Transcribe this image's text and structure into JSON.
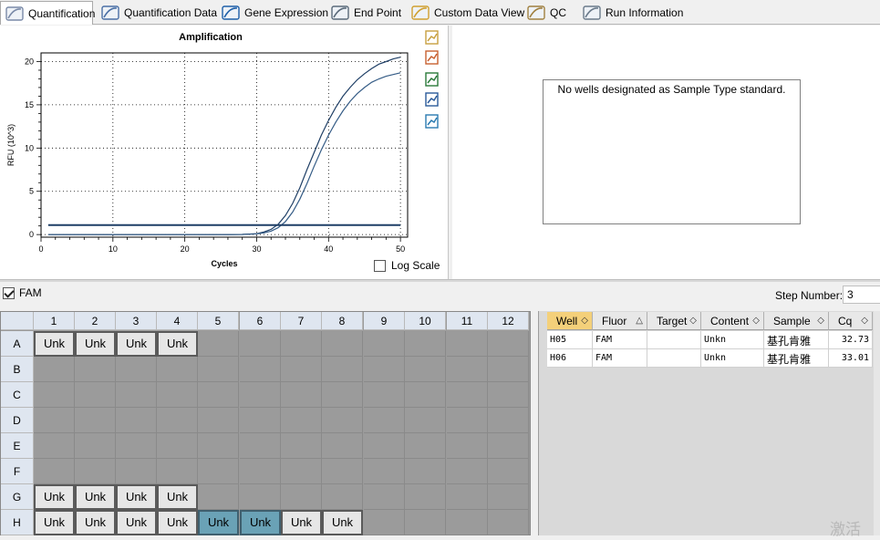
{
  "tabs": [
    {
      "label": "Quantification",
      "icon": "quantification-icon",
      "active": true
    },
    {
      "label": "Quantification Data",
      "icon": "quantification-data-icon"
    },
    {
      "label": "Gene Expression",
      "icon": "gene-expression-icon"
    },
    {
      "label": "End Point",
      "icon": "end-point-icon"
    },
    {
      "label": "Custom Data View",
      "icon": "custom-data-view-icon"
    },
    {
      "label": "QC",
      "icon": "qc-icon"
    },
    {
      "label": "Run Information",
      "icon": "run-information-icon"
    }
  ],
  "chart_panel": {
    "log_scale_label": "Log Scale",
    "log_scale_checked": false,
    "tools": [
      "copy-icon",
      "export-icon",
      "save-image-icon",
      "zoom-icon",
      "curve-settings-icon"
    ]
  },
  "chart_data": {
    "type": "line",
    "title": "Amplification",
    "xlabel": "Cycles",
    "ylabel": "RFU (10^3)",
    "xlim": [
      0,
      51
    ],
    "ylim": [
      -0.3,
      21
    ],
    "xticks": [
      0,
      10,
      20,
      30,
      40,
      50
    ],
    "yticks": [
      0,
      5,
      10,
      15,
      20
    ],
    "grid": "dotted",
    "threshold": 1.1,
    "series": [
      {
        "well": "H05",
        "color": "#1f3f66",
        "x": [
          1,
          5,
          10,
          15,
          20,
          25,
          28,
          30,
          31,
          32,
          33,
          34,
          35,
          36,
          37,
          38,
          39,
          40,
          41,
          42,
          43,
          44,
          45,
          46,
          47,
          48,
          49,
          50
        ],
        "y": [
          0.0,
          0.0,
          0.0,
          0.0,
          0.0,
          0.0,
          0.02,
          0.1,
          0.3,
          0.6,
          1.2,
          2.2,
          3.6,
          5.4,
          7.5,
          9.5,
          11.5,
          13.2,
          14.7,
          16.0,
          17.0,
          17.9,
          18.6,
          19.2,
          19.7,
          20.0,
          20.3,
          20.5
        ]
      },
      {
        "well": "H06",
        "color": "#355c86",
        "x": [
          1,
          5,
          10,
          15,
          20,
          25,
          28,
          30,
          31,
          32,
          33,
          34,
          35,
          36,
          37,
          38,
          39,
          40,
          41,
          42,
          43,
          44,
          45,
          46,
          47,
          48,
          49,
          50
        ],
        "y": [
          0.0,
          0.0,
          0.0,
          0.0,
          0.0,
          0.0,
          0.02,
          0.08,
          0.2,
          0.4,
          0.8,
          1.5,
          2.6,
          4.1,
          5.9,
          7.9,
          9.8,
          11.5,
          13.0,
          14.3,
          15.4,
          16.3,
          17.0,
          17.6,
          18.0,
          18.3,
          18.5,
          18.7
        ]
      }
    ]
  },
  "right_panel": {
    "message": "No wells designated as Sample Type standard."
  },
  "fluor_bar": {
    "fam_label": "FAM",
    "fam_checked": true,
    "step_label": "Step Number:",
    "step_value": "3"
  },
  "plate": {
    "columns": [
      "1",
      "2",
      "3",
      "4",
      "5",
      "6",
      "7",
      "8",
      "9",
      "10",
      "11",
      "12"
    ],
    "rows": [
      "A",
      "B",
      "C",
      "D",
      "E",
      "F",
      "G",
      "H"
    ],
    "wells": [
      {
        "row": "A",
        "col": 1,
        "label": "Unk"
      },
      {
        "row": "A",
        "col": 2,
        "label": "Unk"
      },
      {
        "row": "A",
        "col": 3,
        "label": "Unk"
      },
      {
        "row": "A",
        "col": 4,
        "label": "Unk"
      },
      {
        "row": "G",
        "col": 1,
        "label": "Unk"
      },
      {
        "row": "G",
        "col": 2,
        "label": "Unk"
      },
      {
        "row": "G",
        "col": 3,
        "label": "Unk"
      },
      {
        "row": "G",
        "col": 4,
        "label": "Unk"
      },
      {
        "row": "H",
        "col": 1,
        "label": "Unk"
      },
      {
        "row": "H",
        "col": 2,
        "label": "Unk"
      },
      {
        "row": "H",
        "col": 3,
        "label": "Unk"
      },
      {
        "row": "H",
        "col": 4,
        "label": "Unk"
      },
      {
        "row": "H",
        "col": 5,
        "label": "Unk",
        "selected": true
      },
      {
        "row": "H",
        "col": 6,
        "label": "Unk",
        "selected": true
      },
      {
        "row": "H",
        "col": 7,
        "label": "Unk"
      },
      {
        "row": "H",
        "col": 8,
        "label": "Unk"
      }
    ]
  },
  "results": {
    "columns": [
      "Well",
      "Fluor",
      "Target",
      "Content",
      "Sample",
      "Cq"
    ],
    "rows": [
      [
        "H05",
        "FAM",
        "",
        "Unkn",
        "基孔肯雅",
        "32.73"
      ],
      [
        "H06",
        "FAM",
        "",
        "Unkn",
        "基孔肯雅",
        "33.01"
      ]
    ]
  },
  "watermark": "激活"
}
